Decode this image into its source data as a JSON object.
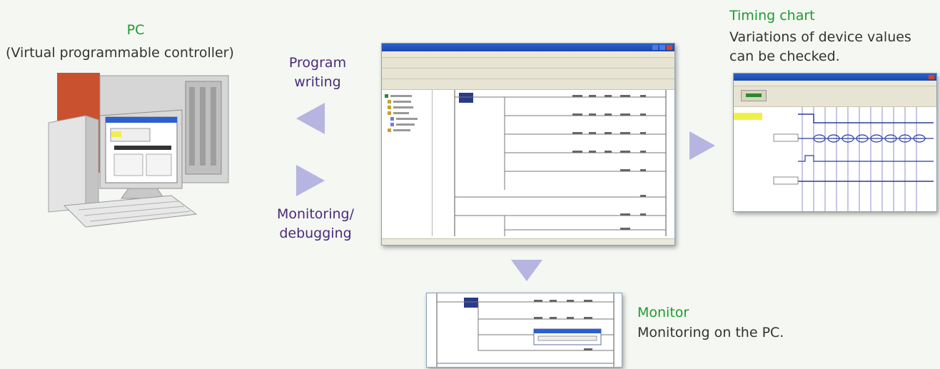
{
  "pc": {
    "title": "PC",
    "subtitle": "(Virtual programmable controller)"
  },
  "program_writing": {
    "line1": "Program",
    "line2": "writing"
  },
  "monitoring_debugging": {
    "line1": "Monitoring/",
    "line2": "debugging"
  },
  "timing_chart": {
    "title": "Timing chart",
    "line1": "Variations of device values",
    "line2": "can be checked."
  },
  "monitor": {
    "title": "Monitor",
    "desc": "Monitoring on the PC."
  },
  "colors": {
    "heading_green": "#1f9a2e",
    "label_purple": "#4a2a7c",
    "arrow_fill": "#b6b4e0"
  }
}
